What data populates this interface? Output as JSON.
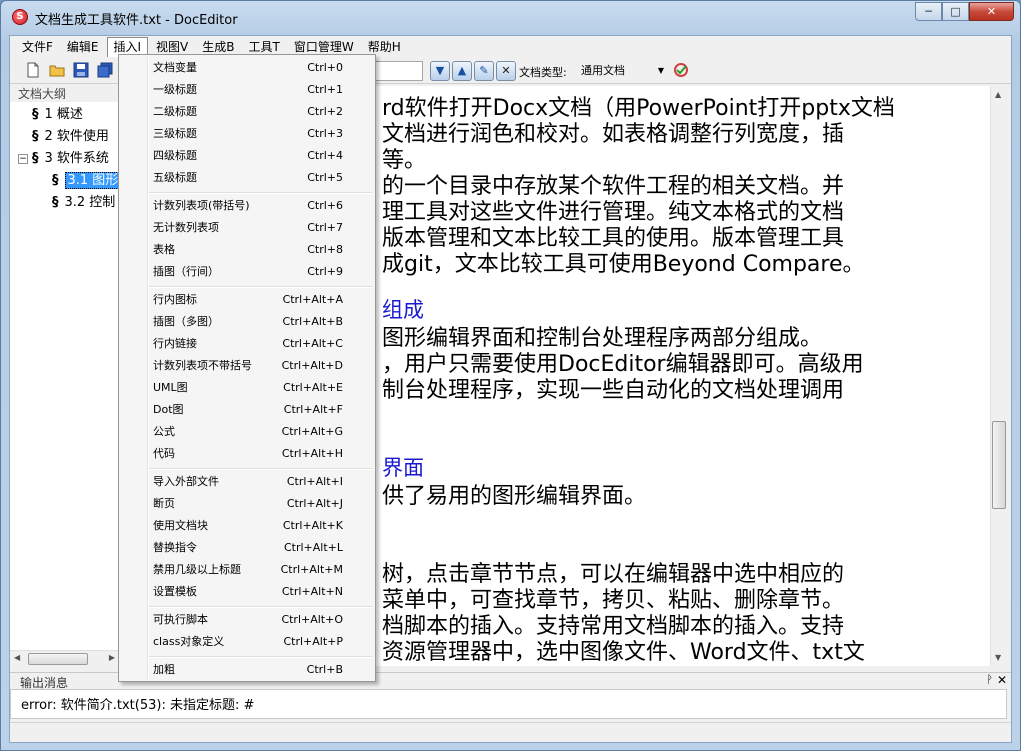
{
  "window": {
    "title": "文档生成工具软件.txt - DocEditor",
    "app_icon_glyph": "S",
    "minimize_glyph": "─",
    "maximize_glyph": "□",
    "close_glyph": "✕"
  },
  "menubar": {
    "items": [
      "文件F",
      "编辑E",
      "插入I",
      "视图V",
      "生成B",
      "工具T",
      "窗口管理W",
      "帮助H"
    ],
    "active_index": 2
  },
  "toolbar": {
    "doc_type_label": "文档类型:",
    "doc_type_value": "通用文档",
    "icons": [
      "new-file-icon",
      "open-folder-icon",
      "save-icon",
      "save-all-icon",
      "nav-down-icon",
      "nav-up-icon",
      "replace-icon",
      "clear-icon",
      "refresh-check-icon"
    ]
  },
  "outline": {
    "header": "文档大纲",
    "items": [
      {
        "glyph": "§",
        "text": "1 概述"
      },
      {
        "glyph": "§",
        "text": "2 软件使用"
      },
      {
        "glyph": "§",
        "text": "3 软件系统"
      },
      {
        "glyph": "§",
        "text": "3.1 图形"
      },
      {
        "glyph": "§",
        "text": "3.2 控制"
      }
    ],
    "expander": "⊟"
  },
  "editor": {
    "lines": [
      {
        "text": "rd软件打开Docx文档（用PowerPoint打开pptx文档",
        "heading": false
      },
      {
        "text": "文档进行润色和校对。如表格调整行列宽度，插",
        "heading": false
      },
      {
        "text": "等。",
        "heading": false
      },
      {
        "text": "的一个目录中存放某个软件工程的相关文档。并",
        "heading": false
      },
      {
        "text": "理工具对这些文件进行管理。纯文本格式的文档",
        "heading": false
      },
      {
        "text": "版本管理和文本比较工具的使用。版本管理工具",
        "heading": false
      },
      {
        "text": "成git，文本比较工具可使用Beyond Compare。",
        "heading": false
      },
      {
        "text": "组成",
        "heading": true
      },
      {
        "text": "图形编辑界面和控制台处理程序两部分组成。",
        "heading": false
      },
      {
        "text": "，用户只需要使用DocEditor编辑器即可。高级用",
        "heading": false
      },
      {
        "text": "制台处理程序，实现一些自动化的文档处理调用",
        "heading": false
      },
      {
        "text": "界面",
        "heading": true
      },
      {
        "text": "供了易用的图形编辑界面。",
        "heading": false
      },
      {
        "text": "树，点击章节节点，可以在编辑器中选中相应的",
        "heading": false
      },
      {
        "text": "菜单中，可查找章节，拷贝、粘贴、删除章节。",
        "heading": false
      },
      {
        "text": "档脚本的插入。支持常用文档脚本的插入。支持",
        "heading": false
      },
      {
        "text": "资源管理器中，选中图像文件、Word文件、txt文",
        "heading": false
      }
    ]
  },
  "output": {
    "header": "输出消息",
    "pin_glyph": "ᚹ",
    "close_glyph": "✕",
    "message": "error: 软件简介.txt(53): 未指定标题: #"
  },
  "insert_menu": {
    "groups": [
      [
        {
          "label": "文档变量",
          "shortcut": "Ctrl+0"
        },
        {
          "label": "一级标题",
          "shortcut": "Ctrl+1"
        },
        {
          "label": "二级标题",
          "shortcut": "Ctrl+2"
        },
        {
          "label": "三级标题",
          "shortcut": "Ctrl+3"
        },
        {
          "label": "四级标题",
          "shortcut": "Ctrl+4"
        },
        {
          "label": "五级标题",
          "shortcut": "Ctrl+5"
        }
      ],
      [
        {
          "label": "计数列表项(带括号)",
          "shortcut": "Ctrl+6"
        },
        {
          "label": "无计数列表项",
          "shortcut": "Ctrl+7"
        },
        {
          "label": "表格",
          "shortcut": "Ctrl+8"
        },
        {
          "label": "插图（行间）",
          "shortcut": "Ctrl+9"
        }
      ],
      [
        {
          "label": "行内图标",
          "shortcut": "Ctrl+Alt+A"
        },
        {
          "label": "插图（多图）",
          "shortcut": "Ctrl+Alt+B"
        },
        {
          "label": "行内链接",
          "shortcut": "Ctrl+Alt+C"
        },
        {
          "label": "计数列表项不带括号",
          "shortcut": "Ctrl+Alt+D"
        },
        {
          "label": "UML图",
          "shortcut": "Ctrl+Alt+E"
        },
        {
          "label": "Dot图",
          "shortcut": "Ctrl+Alt+F"
        },
        {
          "label": "公式",
          "shortcut": "Ctrl+Alt+G"
        },
        {
          "label": "代码",
          "shortcut": "Ctrl+Alt+H"
        }
      ],
      [
        {
          "label": "导入外部文件",
          "shortcut": "Ctrl+Alt+I"
        },
        {
          "label": "断页",
          "shortcut": "Ctrl+Alt+J"
        },
        {
          "label": "使用文档块",
          "shortcut": "Ctrl+Alt+K"
        },
        {
          "label": "替换指令",
          "shortcut": "Ctrl+Alt+L"
        },
        {
          "label": "禁用几级以上标题",
          "shortcut": "Ctrl+Alt+M"
        },
        {
          "label": "设置模板",
          "shortcut": "Ctrl+Alt+N"
        }
      ],
      [
        {
          "label": "可执行脚本",
          "shortcut": "Ctrl+Alt+O"
        },
        {
          "label": "class对象定义",
          "shortcut": "Ctrl+Alt+P"
        }
      ],
      [
        {
          "label": "加粗",
          "shortcut": "Ctrl+B"
        }
      ]
    ]
  },
  "colors": {
    "heading_blue": "#1a1ad0",
    "selection": "#3399ff"
  }
}
